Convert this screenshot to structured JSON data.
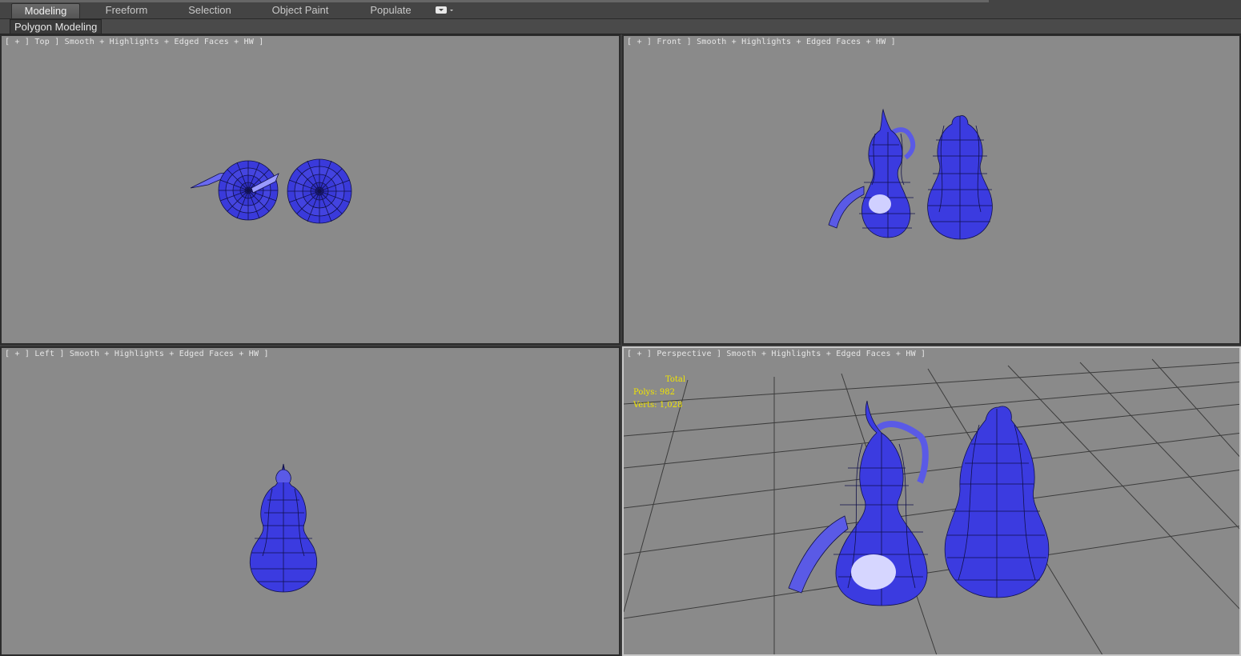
{
  "ribbon": {
    "tabs": [
      {
        "label": "Modeling",
        "active": true
      },
      {
        "label": "Freeform",
        "active": false
      },
      {
        "label": "Selection",
        "active": false
      },
      {
        "label": "Object Paint",
        "active": false
      },
      {
        "label": "Populate",
        "active": false
      }
    ],
    "extra_icon": "dropdown-toggle-icon",
    "panel_label": "Polygon Modeling"
  },
  "viewports": {
    "top": {
      "label": "[ + ] Top ] Smooth + Highlights + Edged Faces + HW ]"
    },
    "front": {
      "label": "[ + ] Front ] Smooth + Highlights + Edged Faces + HW ]"
    },
    "left": {
      "label": "[ + ] Left ] Smooth + Highlights + Edged Faces + HW ]"
    },
    "perspective": {
      "label": "[ + ] Perspective ] Smooth + Highlights + Edged Faces + HW ]",
      "stats": {
        "title": "Total",
        "polys": "Polys: 982",
        "verts": "Verts: 1,028"
      }
    }
  },
  "colors": {
    "viewport_bg": "#8a8a8a",
    "gourd_blue": "#3d3ddf",
    "stats_text": "#f2e600"
  }
}
